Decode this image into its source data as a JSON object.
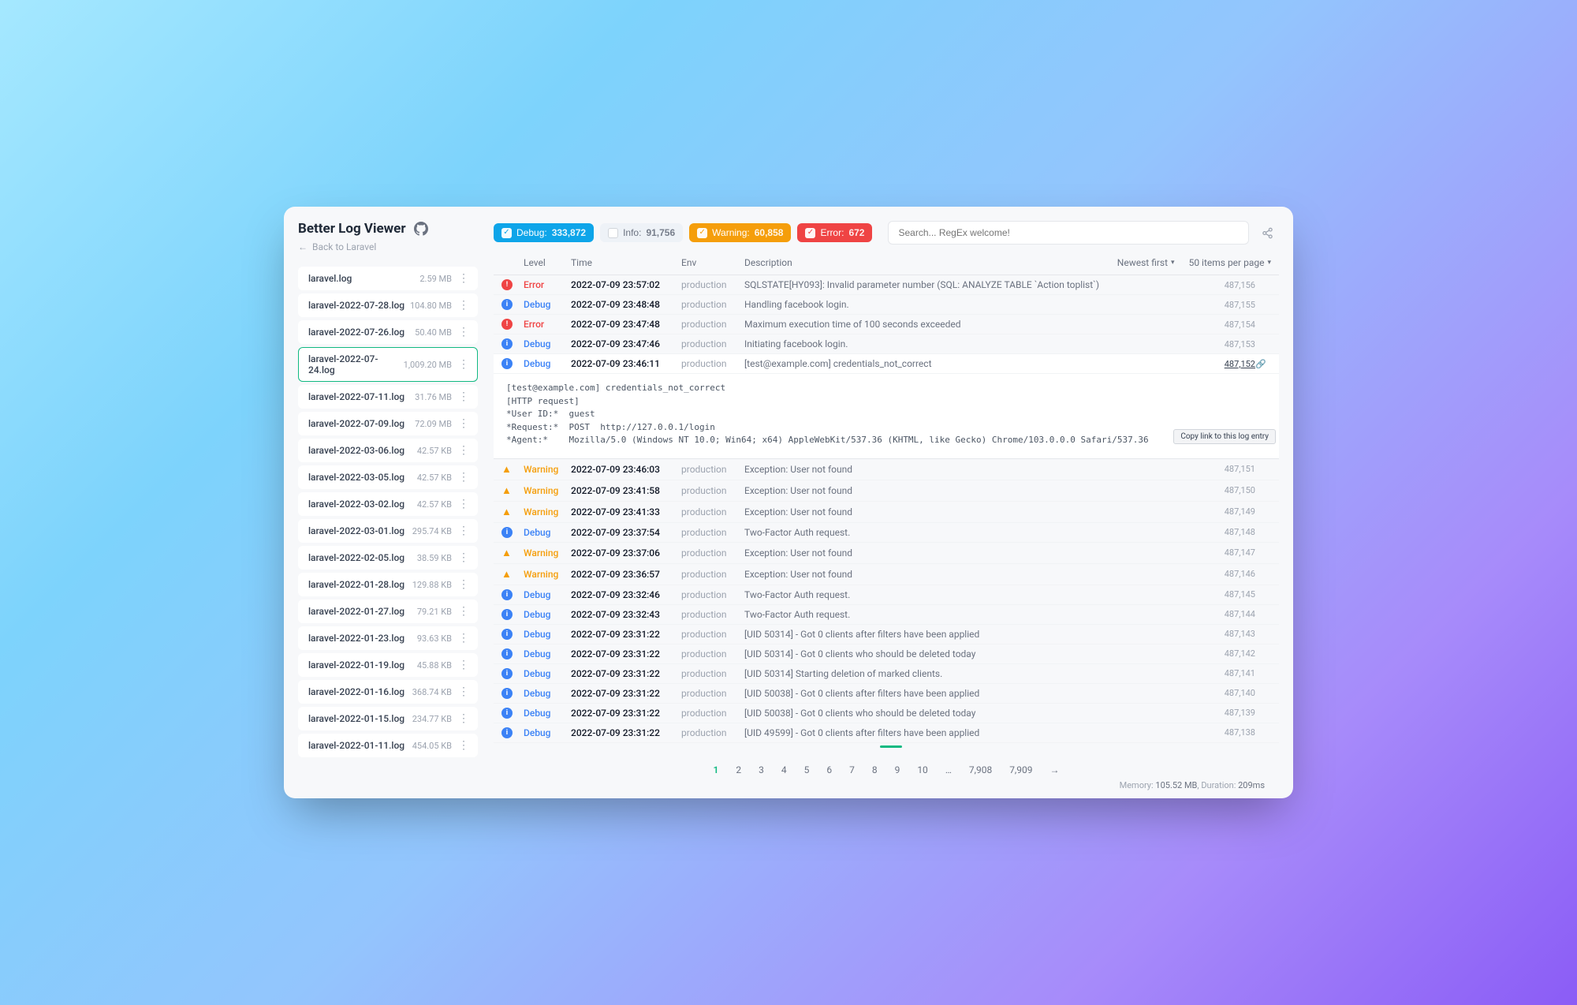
{
  "app": {
    "title": "Better Log Viewer",
    "back_label": "Back to Laravel"
  },
  "filters": {
    "debug": {
      "label": "Debug:",
      "count": "333,872",
      "checked": true
    },
    "info": {
      "label": "Info:",
      "count": "91,756",
      "checked": false
    },
    "warn": {
      "label": "Warning:",
      "count": "60,858",
      "checked": true
    },
    "error": {
      "label": "Error:",
      "count": "672",
      "checked": true
    }
  },
  "search": {
    "placeholder": "Search... RegEx welcome!"
  },
  "headers": {
    "level": "Level",
    "time": "Time",
    "env": "Env",
    "desc": "Description",
    "sort": "Newest first",
    "perpage": "50 items per page"
  },
  "tooltip": "Copy link to this log entry",
  "files": [
    {
      "name": "laravel.log",
      "size": "2.59 MB"
    },
    {
      "name": "laravel-2022-07-28.log",
      "size": "104.80 MB"
    },
    {
      "name": "laravel-2022-07-26.log",
      "size": "50.40 MB"
    },
    {
      "name": "laravel-2022-07-24.log",
      "size": "1,009.20 MB",
      "selected": true
    },
    {
      "name": "laravel-2022-07-11.log",
      "size": "31.76 MB"
    },
    {
      "name": "laravel-2022-07-09.log",
      "size": "72.09 MB"
    },
    {
      "name": "laravel-2022-03-06.log",
      "size": "42.57 KB"
    },
    {
      "name": "laravel-2022-03-05.log",
      "size": "42.57 KB"
    },
    {
      "name": "laravel-2022-03-02.log",
      "size": "42.57 KB"
    },
    {
      "name": "laravel-2022-03-01.log",
      "size": "295.74 KB"
    },
    {
      "name": "laravel-2022-02-05.log",
      "size": "38.59 KB"
    },
    {
      "name": "laravel-2022-01-28.log",
      "size": "129.88 KB"
    },
    {
      "name": "laravel-2022-01-27.log",
      "size": "79.21 KB"
    },
    {
      "name": "laravel-2022-01-23.log",
      "size": "93.63 KB"
    },
    {
      "name": "laravel-2022-01-19.log",
      "size": "45.88 KB"
    },
    {
      "name": "laravel-2022-01-16.log",
      "size": "368.74 KB"
    },
    {
      "name": "laravel-2022-01-15.log",
      "size": "234.77 KB"
    },
    {
      "name": "laravel-2022-01-11.log",
      "size": "454.05 KB"
    }
  ],
  "logs": [
    {
      "level": "Error",
      "time": "2022-07-09 23:57:02",
      "env": "production",
      "desc": "SQLSTATE[HY093]: Invalid parameter number (SQL: ANALYZE TABLE `Action toplist`)",
      "idx": "487,156"
    },
    {
      "level": "Debug",
      "time": "2022-07-09 23:48:48",
      "env": "production",
      "desc": "Handling facebook login.",
      "idx": "487,155"
    },
    {
      "level": "Error",
      "time": "2022-07-09 23:47:48",
      "env": "production",
      "desc": "Maximum execution time of 100 seconds exceeded",
      "idx": "487,154"
    },
    {
      "level": "Debug",
      "time": "2022-07-09 23:47:46",
      "env": "production",
      "desc": "Initiating facebook login.",
      "idx": "487,153"
    },
    {
      "level": "Debug",
      "time": "2022-07-09 23:46:11",
      "env": "production",
      "desc": "[test@example.com] credentials_not_correct",
      "idx": "487,152",
      "expanded": true,
      "link": true
    },
    {
      "level": "Warning",
      "time": "2022-07-09 23:46:03",
      "env": "production",
      "desc": "Exception: User not found",
      "idx": "487,151"
    },
    {
      "level": "Warning",
      "time": "2022-07-09 23:41:58",
      "env": "production",
      "desc": "Exception: User not found",
      "idx": "487,150"
    },
    {
      "level": "Warning",
      "time": "2022-07-09 23:41:33",
      "env": "production",
      "desc": "Exception: User not found",
      "idx": "487,149"
    },
    {
      "level": "Debug",
      "time": "2022-07-09 23:37:54",
      "env": "production",
      "desc": "Two-Factor Auth request.",
      "idx": "487,148"
    },
    {
      "level": "Warning",
      "time": "2022-07-09 23:37:06",
      "env": "production",
      "desc": "Exception: User not found",
      "idx": "487,147"
    },
    {
      "level": "Warning",
      "time": "2022-07-09 23:36:57",
      "env": "production",
      "desc": "Exception: User not found",
      "idx": "487,146"
    },
    {
      "level": "Debug",
      "time": "2022-07-09 23:32:46",
      "env": "production",
      "desc": "Two-Factor Auth request.",
      "idx": "487,145"
    },
    {
      "level": "Debug",
      "time": "2022-07-09 23:32:43",
      "env": "production",
      "desc": "Two-Factor Auth request.",
      "idx": "487,144"
    },
    {
      "level": "Debug",
      "time": "2022-07-09 23:31:22",
      "env": "production",
      "desc": "[UID 50314] - Got 0 clients after filters have been applied",
      "idx": "487,143"
    },
    {
      "level": "Debug",
      "time": "2022-07-09 23:31:22",
      "env": "production",
      "desc": "[UID 50314] - Got 0 clients who should be deleted today",
      "idx": "487,142"
    },
    {
      "level": "Debug",
      "time": "2022-07-09 23:31:22",
      "env": "production",
      "desc": "[UID 50314] Starting deletion of marked clients.",
      "idx": "487,141"
    },
    {
      "level": "Debug",
      "time": "2022-07-09 23:31:22",
      "env": "production",
      "desc": "[UID 50038] - Got 0 clients after filters have been applied",
      "idx": "487,140"
    },
    {
      "level": "Debug",
      "time": "2022-07-09 23:31:22",
      "env": "production",
      "desc": "[UID 50038] - Got 0 clients who should be deleted today",
      "idx": "487,139"
    },
    {
      "level": "Debug",
      "time": "2022-07-09 23:31:22",
      "env": "production",
      "desc": "[UID 49599] - Got 0 clients after filters have been applied",
      "idx": "487,138"
    }
  ],
  "expanded_detail": "[test@example.com] credentials_not_correct\n[HTTP request]\n*User ID:*  guest\n*Request:*  POST  http://127.0.0.1/login\n*Agent:*    Mozilla/5.0 (Windows NT 10.0; Win64; x64) AppleWebKit/537.36 (KHTML, like Gecko) Chrome/103.0.0.0 Safari/537.36",
  "pagination": {
    "pages": [
      "1",
      "2",
      "3",
      "4",
      "5",
      "6",
      "7",
      "8",
      "9",
      "10",
      "…",
      "7,908",
      "7,909"
    ],
    "active": "1",
    "next": "→"
  },
  "footer": {
    "memory_label": "Memory:",
    "memory_value": "105.52 MB",
    "duration_label": "Duration:",
    "duration_value": "209ms"
  }
}
